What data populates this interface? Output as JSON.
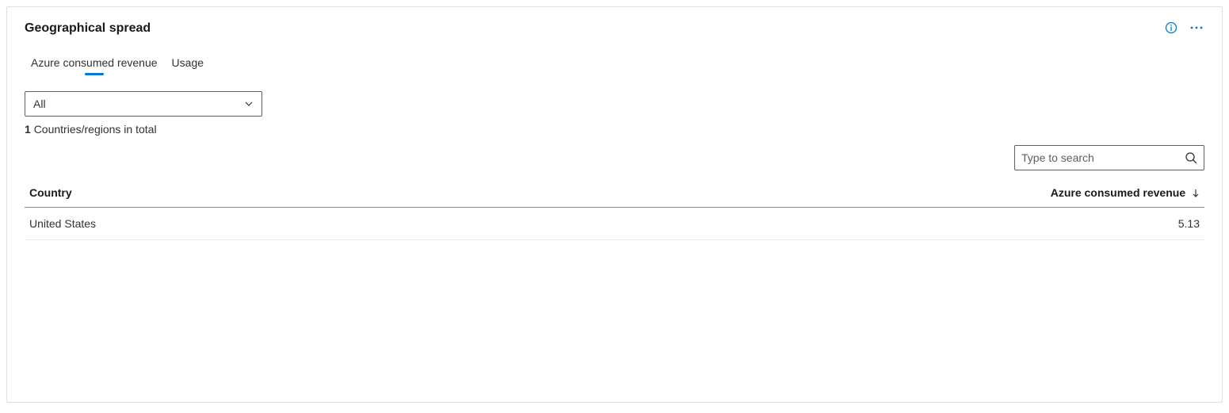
{
  "card": {
    "title": "Geographical spread"
  },
  "tabs": {
    "revenue": "Azure consumed revenue",
    "usage": "Usage",
    "active": "revenue"
  },
  "filter": {
    "selected": "All",
    "count": "1",
    "count_label": "Countries/regions in total"
  },
  "search": {
    "placeholder": "Type to search"
  },
  "table": {
    "headers": {
      "country": "Country",
      "revenue": "Azure consumed revenue"
    },
    "rows": [
      {
        "country": "United States",
        "revenue": "5.13"
      }
    ]
  }
}
